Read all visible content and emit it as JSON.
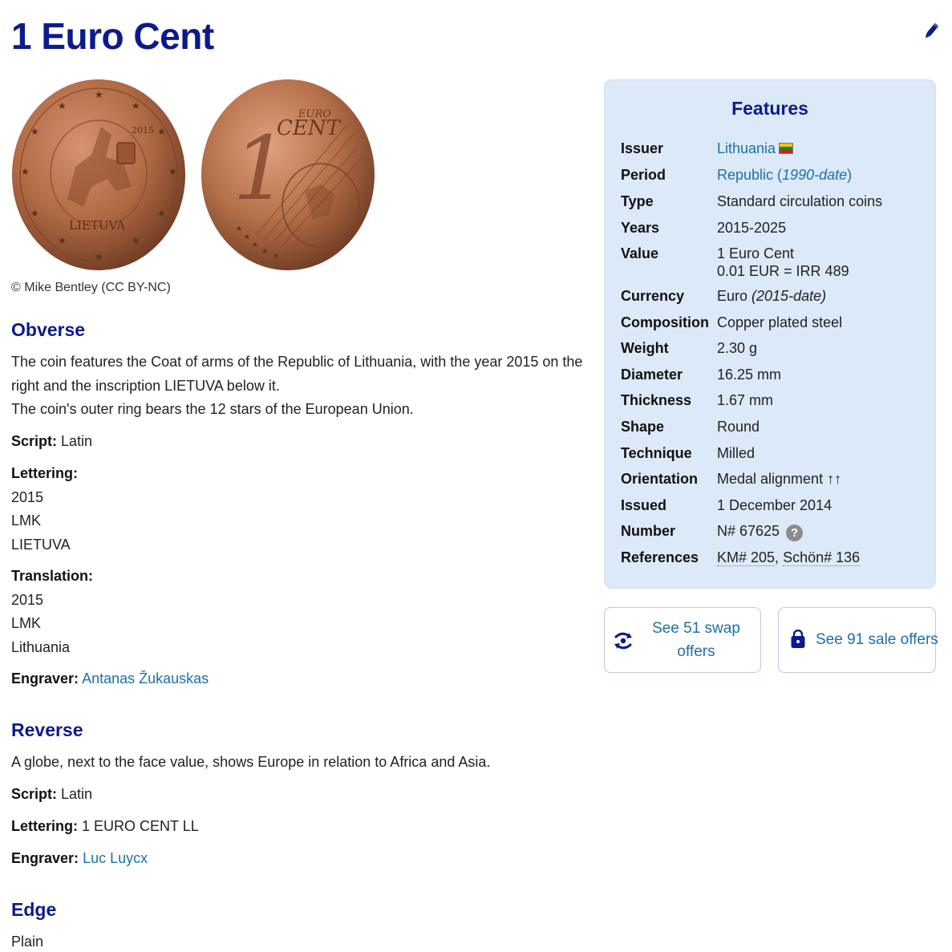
{
  "title": "1 Euro Cent",
  "images": {
    "obverse_alt": "Obverse of 1 Euro Cent, Lithuania",
    "reverse_alt": "Reverse of 1 Euro Cent",
    "credit": "© Mike Bentley (CC BY-NC)"
  },
  "obverse": {
    "heading": "Obverse",
    "desc_1": "The coin features the Coat of arms of the Republic of Lithuania, with the year 2015 on the",
    "desc_2": "right and the inscription LIETUVA below it.",
    "desc_3": "The coin's outer ring bears the 12 stars of the European Union.",
    "script_label": "Script:",
    "script_value": "Latin",
    "lettering_label": "Lettering:",
    "lettering": [
      "2015",
      "LMK",
      "LIETUVA"
    ],
    "translation_label": "Translation:",
    "translation": [
      "2015",
      "LMK",
      "Lithuania"
    ],
    "engraver_label": "Engraver:",
    "engraver": "Antanas Žukauskas"
  },
  "reverse": {
    "heading": "Reverse",
    "desc": "A globe, next to the face value, shows Europe in relation to Africa and Asia.",
    "script_label": "Script:",
    "script_value": "Latin",
    "lettering_label": "Lettering:",
    "lettering_value": "1 EURO CENT LL",
    "engraver_label": "Engraver:",
    "engraver": "Luc Luycx"
  },
  "edge": {
    "heading": "Edge",
    "value": "Plain"
  },
  "features": {
    "heading": "Features",
    "issuer_label": "Issuer",
    "issuer_value": "Lithuania",
    "period_label": "Period",
    "period_value": "Republic",
    "period_open": " (",
    "period_range": "1990-date",
    "period_close": ")",
    "type_label": "Type",
    "type_value": "Standard circulation coins",
    "years_label": "Years",
    "years_value": "2015-2025",
    "value_label": "Value",
    "value_value": "1 Euro Cent",
    "value_value_2": "0.01 EUR = IRR 489",
    "currency_label": "Currency",
    "currency_value": "Euro ",
    "currency_range": "(2015-date)",
    "composition_label": "Composition",
    "composition_value": "Copper plated steel",
    "weight_label": "Weight",
    "weight_value": "2.30 g",
    "diameter_label": "Diameter",
    "diameter_value": "16.25 mm",
    "thickness_label": "Thickness",
    "thickness_value": "1.67 mm",
    "shape_label": "Shape",
    "shape_value": "Round",
    "technique_label": "Technique",
    "technique_value": "Milled",
    "orientation_label": "Orientation",
    "orientation_value": "Medal alignment ↑↑",
    "issued_label": "Issued",
    "issued_value": "1 December 2014",
    "number_label": "Number",
    "number_value": "N# 67625",
    "help_glyph": "?",
    "references_label": "References",
    "ref_km": "KM# 205",
    "ref_sep": ", ",
    "ref_schon": "Schön# 136"
  },
  "offers": {
    "swap_line1": "See 51 swap",
    "swap_line2": "offers",
    "sale_label": "See 91 sale offers"
  },
  "colors": {
    "heading": "#0d1a8c",
    "link": "#1f6fa8",
    "features_bg": "#dbe9f8",
    "copper": "#b06a45"
  },
  "icons": {
    "edit": "pencil-icon",
    "swap": "swap-icon",
    "sale": "shopping-bag-icon"
  }
}
